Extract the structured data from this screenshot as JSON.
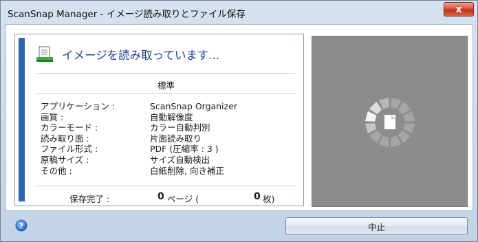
{
  "window": {
    "title": "ScanSnap Manager - イメージ読み取りとファイル保存",
    "close_glyph": "x"
  },
  "status": {
    "text": "イメージを読み取っています..."
  },
  "profile": {
    "name": "標準"
  },
  "settings": [
    {
      "label": "アプリケーション :",
      "value": "ScanSnap Organizer"
    },
    {
      "label": "画質 :",
      "value": "自動解像度"
    },
    {
      "label": "カラーモード :",
      "value": "カラー自動判別"
    },
    {
      "label": "読み取り面 :",
      "value": "片面読み取り"
    },
    {
      "label": "ファイル形式 :",
      "value": "PDF (圧縮率 : 3 )"
    },
    {
      "label": "原稿サイズ :",
      "value": "サイズ自動検出"
    },
    {
      "label": "その他 :",
      "value": "白紙削除, 向き補正"
    }
  ],
  "progress": {
    "saved_label": "保存完了 :",
    "pages_count": "0",
    "pages_unit": "ページ (",
    "sheets_count": "0",
    "sheets_unit": "枚)"
  },
  "buttons": {
    "stop_label": "中止",
    "help_glyph": "?"
  },
  "colors": {
    "accent": "#2f63b4",
    "status_text": "#1b3f96",
    "preview_bg": "#8c8c8c",
    "close_red": "#c0321f"
  },
  "icons": {
    "status": "scan-document-icon",
    "help": "help-icon",
    "preview": "loading-spinner-icon"
  }
}
